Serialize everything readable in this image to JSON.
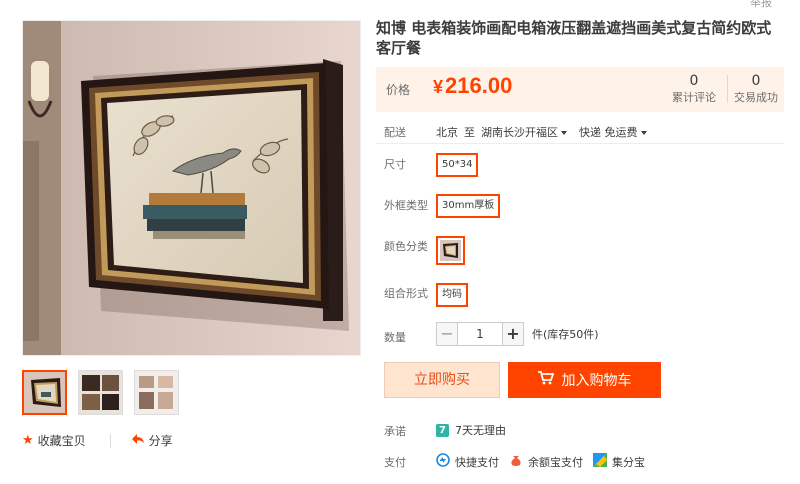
{
  "header": {
    "report_label": "举报"
  },
  "gallery": {
    "actions": {
      "favorite_label": "收藏宝贝",
      "share_label": "分享"
    }
  },
  "product": {
    "title": "知博 电表箱装饰画配电箱液压翻盖遮挡画美式复古简约欧式客厅餐",
    "price_label": "价格",
    "currency": "¥",
    "price": "216.00",
    "stats": {
      "reviews": {
        "value": "0",
        "label": "累计评论"
      },
      "deals": {
        "value": "0",
        "label": "交易成功"
      }
    },
    "delivery": {
      "label": "配送",
      "from": "北京",
      "to_word": "至",
      "destination": "湖南长沙开福区",
      "shipping": "快递 免运费"
    },
    "options": {
      "size": {
        "label": "尺寸",
        "selected": "50*34"
      },
      "frame": {
        "label": "外框类型",
        "selected": "30mm厚板"
      },
      "color": {
        "label": "颜色分类"
      },
      "combo": {
        "label": "组合形式",
        "selected": "均码"
      }
    },
    "quantity": {
      "label": "数量",
      "minus": "−",
      "value": "1",
      "plus": "+",
      "stock_text": "件(库存50件)"
    },
    "buttons": {
      "buy_now": "立即购买",
      "add_to_cart": "加入购物车"
    },
    "promise": {
      "label": "承诺",
      "badge": "7",
      "text": "7天无理由"
    },
    "payment": {
      "label": "支付",
      "methods": [
        "快捷支付",
        "余额宝支付",
        "集分宝"
      ]
    }
  },
  "colors": {
    "accent": "#ff4400",
    "price_bg": "#fff2e8",
    "buy_now_bg": "#ffe4d0"
  }
}
